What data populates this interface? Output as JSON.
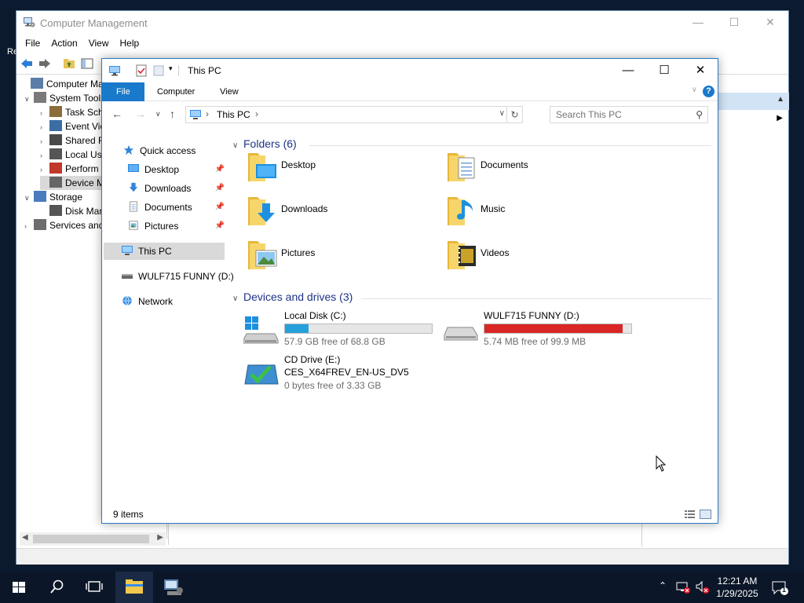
{
  "desktop": {
    "label": "Re"
  },
  "computer_management": {
    "title": "Computer Management",
    "menu": [
      "File",
      "Action",
      "View",
      "Help"
    ],
    "tree": [
      {
        "label": "Computer Manag",
        "level": 0,
        "arrow": ""
      },
      {
        "label": "System Tools",
        "level": 1,
        "arrow": "v"
      },
      {
        "label": "Task Sch",
        "level": 2,
        "arrow": ">"
      },
      {
        "label": "Event Vie",
        "level": 2,
        "arrow": ">"
      },
      {
        "label": "Shared F",
        "level": 2,
        "arrow": ">"
      },
      {
        "label": "Local Us",
        "level": 2,
        "arrow": ">"
      },
      {
        "label": "Perform",
        "level": 2,
        "arrow": ">"
      },
      {
        "label": "Device M",
        "level": 2,
        "arrow": ""
      },
      {
        "label": "Storage",
        "level": 1,
        "arrow": "v"
      },
      {
        "label": "Disk Man",
        "level": 2,
        "arrow": ""
      },
      {
        "label": "Services and",
        "level": 1,
        "arrow": ">"
      }
    ],
    "actions_row_suffix": "s"
  },
  "explorer": {
    "title": "This PC",
    "ribbon_tabs": [
      "File",
      "Computer",
      "View"
    ],
    "address": {
      "crumb": "This PC"
    },
    "search_placeholder": "Search This PC",
    "nav": {
      "quick_access": "Quick access",
      "pinned": [
        "Desktop",
        "Downloads",
        "Documents",
        "Pictures"
      ],
      "this_pc": "This PC",
      "usb_drive": "WULF715 FUNNY (D:)",
      "network": "Network"
    },
    "folders_header": "Folders (6)",
    "folders": [
      "Desktop",
      "Documents",
      "Downloads",
      "Music",
      "Pictures",
      "Videos"
    ],
    "drives_header": "Devices and drives (3)",
    "drives": [
      {
        "name": "Local Disk (C:)",
        "free": "57.9 GB free of 68.8 GB",
        "used_fraction": 0.16,
        "bar_color": "#26a0da"
      },
      {
        "name": "WULF715 FUNNY (D:)",
        "free": "5.74 MB free of 99.9 MB",
        "used_fraction": 0.94,
        "bar_color": "#da2626"
      },
      {
        "name": "CD Drive (E:)",
        "subtitle": "CES_X64FREV_EN-US_DV5",
        "free": "0 bytes free of 3.33 GB"
      }
    ],
    "status_count": "9 items"
  },
  "taskbar": {
    "time": "12:21 AM",
    "date": "1/29/2025",
    "notification_count": "1"
  },
  "colors": {
    "accent": "#1979ca",
    "folder": "#f2c94c",
    "taskbar": "#0b1628"
  }
}
